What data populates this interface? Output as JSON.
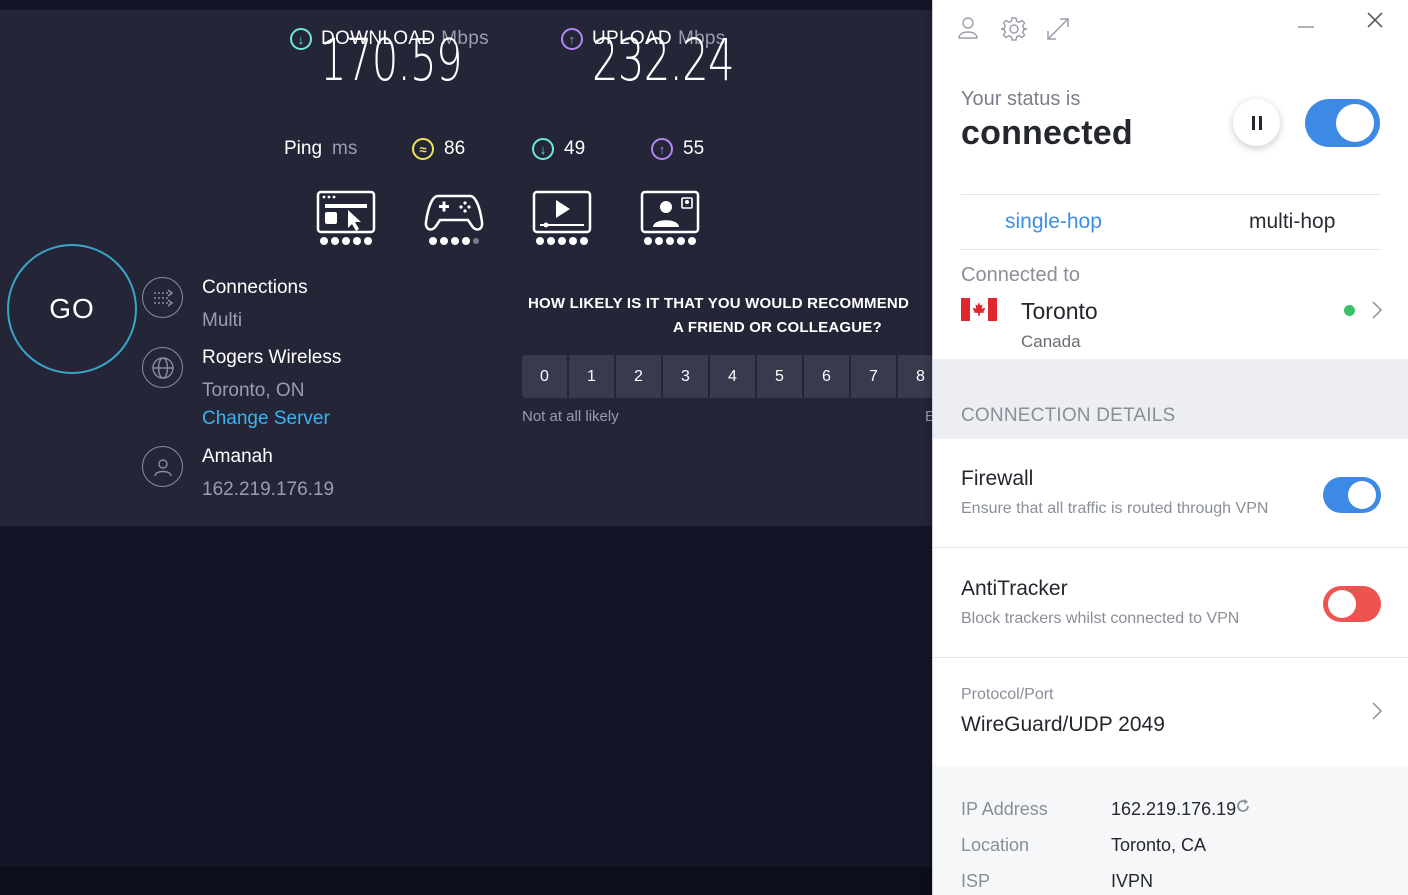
{
  "speedtest": {
    "download": {
      "label": "DOWNLOAD",
      "unit": "Mbps",
      "value": "170.59"
    },
    "upload": {
      "label": "UPLOAD",
      "unit": "Mbps",
      "value": "232.24"
    },
    "ping": {
      "label": "Ping",
      "unit": "ms",
      "idle": "86",
      "download": "49",
      "upload": "55"
    },
    "experience_icons": [
      {
        "icon": "web-browsing-icon",
        "rating": 5
      },
      {
        "icon": "gaming-icon",
        "rating": 4
      },
      {
        "icon": "video-streaming-icon",
        "rating": 5
      },
      {
        "icon": "video-chat-icon",
        "rating": 5
      }
    ],
    "go_label": "GO",
    "connections": {
      "title": "Connections",
      "value": "Multi"
    },
    "host": {
      "title": "Rogers Wireless",
      "location": "Toronto, ON",
      "change_label": "Change Server"
    },
    "user": {
      "title": "Amanah",
      "ip": "162.219.176.19"
    },
    "survey": {
      "question_line1": "HOW LIKELY IS IT THAT YOU WOULD RECOMMEND",
      "question_line2": "A FRIEND OR COLLEAGUE?",
      "options": [
        "0",
        "1",
        "2",
        "3",
        "4",
        "5",
        "6",
        "7",
        "8"
      ],
      "low_label": "Not at all likely",
      "high_label_fragment": "E"
    }
  },
  "vpn": {
    "status_label": "Your status is",
    "status_value": "connected",
    "connection_toggle": {
      "on": true,
      "color": "#3d8ae6"
    },
    "tabs": {
      "single": "single-hop",
      "multi": "multi-hop",
      "active": "single-hop"
    },
    "connected_to_label": "Connected to",
    "server": {
      "city": "Toronto",
      "country": "Canada",
      "status_color": "#3ac26a"
    },
    "details_heading": "CONNECTION DETAILS",
    "firewall": {
      "title": "Firewall",
      "description": "Ensure that all traffic is routed through VPN",
      "on": true,
      "color": "#3d8ae6"
    },
    "antitracker": {
      "title": "AntiTracker",
      "description": "Block trackers whilst connected to VPN",
      "on": false,
      "color": "#ef5350"
    },
    "protocol": {
      "label": "Protocol/Port",
      "value": "WireGuard/UDP 2049"
    },
    "info": {
      "ip_label": "IP Address",
      "ip_value": "162.219.176.19",
      "location_label": "Location",
      "location_value": "Toronto, CA",
      "isp_label": "ISP",
      "isp_value": "IVPN"
    }
  }
}
